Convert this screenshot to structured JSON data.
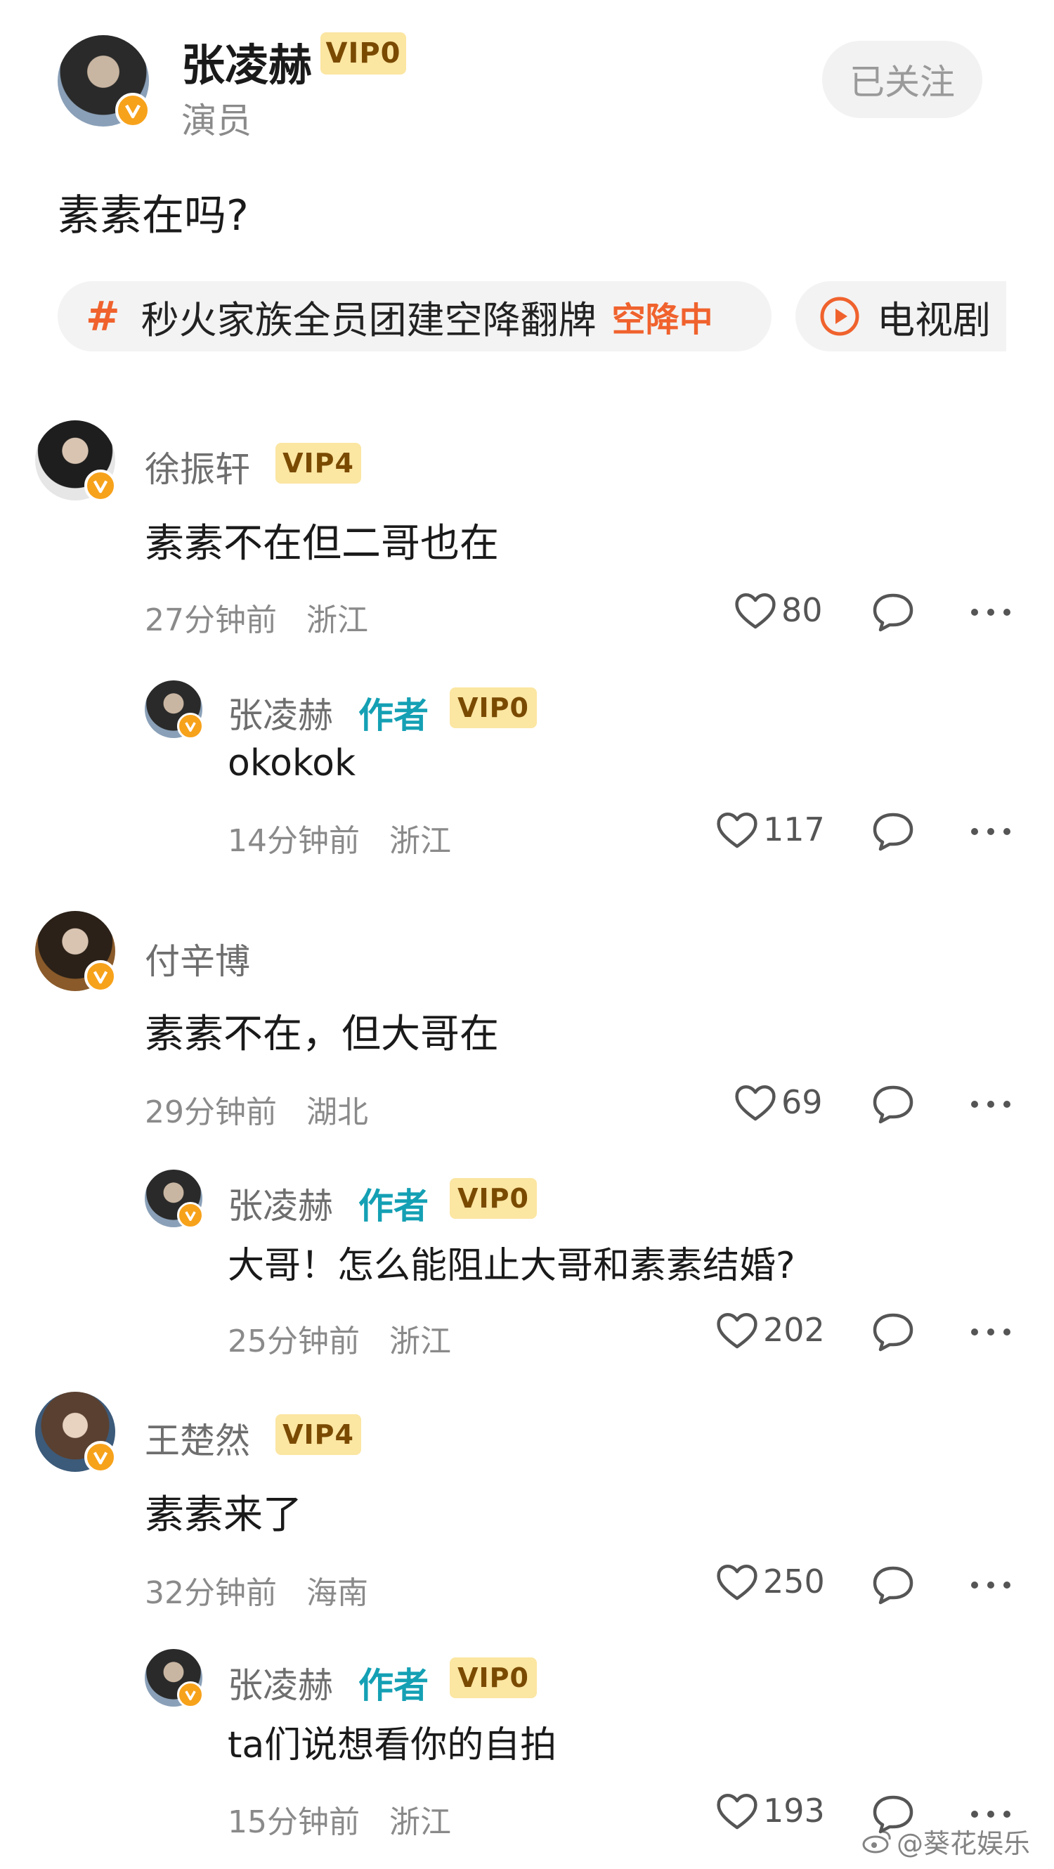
{
  "post": {
    "author_name": "张凌赫",
    "vip": "VIP0",
    "role": "演员",
    "follow_label": "已关注",
    "text": "素素在吗?",
    "topic_text": "秒火家族全员团建空降翻牌",
    "topic_status": "空降中",
    "tv_label": "电视剧"
  },
  "comments": [
    {
      "name": "徐振轩",
      "vip": "VIP4",
      "text": "素素不在但二哥也在",
      "time": "27分钟前",
      "location": "浙江",
      "likes": "80",
      "reply": {
        "name": "张凌赫",
        "author_tag": "作者",
        "vip": "VIP0",
        "text": "okokok",
        "time": "14分钟前",
        "location": "浙江",
        "likes": "117"
      }
    },
    {
      "name": "付辛博",
      "vip": "",
      "text": "素素不在，但大哥在",
      "time": "29分钟前",
      "location": "湖北",
      "likes": "69",
      "reply": {
        "name": "张凌赫",
        "author_tag": "作者",
        "vip": "VIP0",
        "text": "大哥！怎么能阻止大哥和素素结婚?",
        "time": "25分钟前",
        "location": "浙江",
        "likes": "202"
      }
    },
    {
      "name": "王楚然",
      "vip": "VIP4",
      "text": "素素来了",
      "time": "32分钟前",
      "location": "海南",
      "likes": "250",
      "reply": {
        "name": "张凌赫",
        "author_tag": "作者",
        "vip": "VIP0",
        "text": "ta们说想看你的自拍",
        "time": "15分钟前",
        "location": "浙江",
        "likes": "193"
      }
    }
  ],
  "watermark": "@葵花娱乐",
  "colors": {
    "accent_orange": "#f0622d",
    "author_teal": "#14a0b4",
    "vip_bg": "#fbe6a2",
    "badge": "#f7a21b"
  },
  "icons": [
    "heart-icon",
    "comment-icon",
    "more-icon",
    "hash-icon",
    "play-icon",
    "verified-icon"
  ]
}
